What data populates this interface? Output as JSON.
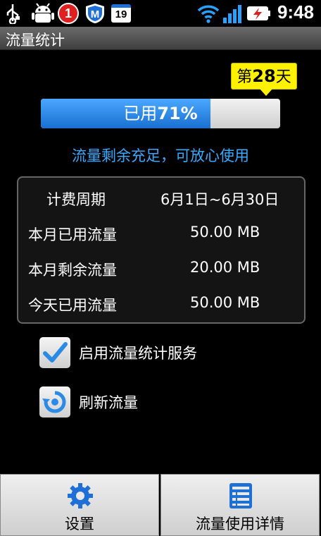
{
  "status_bar": {
    "time": "9:48",
    "notif_badge": "1",
    "calendar_day": "19",
    "icons": [
      "usb-icon",
      "android-debug-icon",
      "alarm-icon",
      "shield-m-icon",
      "calendar-icon",
      "wifi-icon",
      "signal-icon",
      "battery-charging-icon"
    ],
    "colors": {
      "alarm": "#e02020",
      "shield": "#1e6fd6"
    }
  },
  "titlebar": {
    "title": "流量统计"
  },
  "usage": {
    "day_prefix": "第",
    "day_number": "28",
    "day_suffix": "天",
    "used_prefix": "已用",
    "used_percent_text": "71%",
    "used_fraction": 0.71,
    "message": "流量剩余充足，可放心使用"
  },
  "info": {
    "rows": [
      {
        "label": "计费周期",
        "value": "6月1日~6月30日"
      },
      {
        "label": "本月已用流量",
        "value": "50.00 MB"
      },
      {
        "label": "本月剩余流量",
        "value": "20.00 MB"
      },
      {
        "label": "今天已用流量",
        "value": "50.00 MB"
      }
    ]
  },
  "options": {
    "enable_label": "启用流量统计服务",
    "enable_checked": true,
    "refresh_label": "刷新流量"
  },
  "bottom": {
    "settings_label": "设置",
    "details_label": "流量使用详情"
  },
  "colors": {
    "accent": "#38a9ff",
    "badge": "#fff200",
    "progress": "#1a6fd0"
  }
}
